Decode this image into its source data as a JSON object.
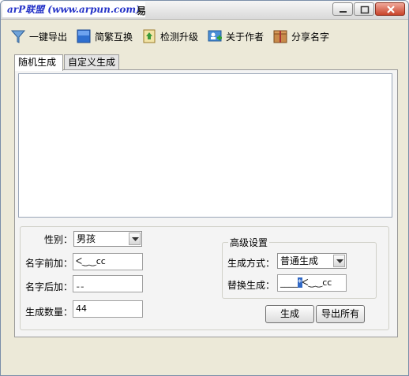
{
  "window": {
    "watermark": "arP联盟 (www.arpun.com)",
    "title_tail": "易"
  },
  "toolbar": {
    "items": [
      {
        "label": "一键导出",
        "icon": "funnel-export-icon"
      },
      {
        "label": "简繁互换",
        "icon": "blue-square-icon"
      },
      {
        "label": "检测升级",
        "icon": "update-check-icon"
      },
      {
        "label": "关于作者",
        "icon": "user-card-icon"
      },
      {
        "label": "分享名字",
        "icon": "share-box-icon"
      }
    ]
  },
  "tabs": [
    {
      "label": "随机生成",
      "active": true
    },
    {
      "label": "自定义生成",
      "active": false
    }
  ],
  "form": {
    "gender_label": "性别：",
    "gender_value": "男孩",
    "prefix_label": "名字前加：",
    "prefix_value": "ᐸ‿‿ᴄᴄ",
    "suffix_label": "名字后加：",
    "suffix_value": "ˍˍ",
    "count_label": "生成数量：",
    "count_value": "44"
  },
  "advanced": {
    "title": "高级设置",
    "mode_label": "生成方式：",
    "mode_value": "普通生成",
    "replace_label": "替换生成：",
    "replace_before": "____",
    "replace_selected": "*",
    "replace_after": "ᐸ‿‿ᴄᴄ"
  },
  "buttons": {
    "generate": "生成",
    "export_all": "导出所有"
  },
  "colors": {
    "watermark": "#2533c8",
    "selection": "#3169c6",
    "close_button": "#c8432a"
  }
}
